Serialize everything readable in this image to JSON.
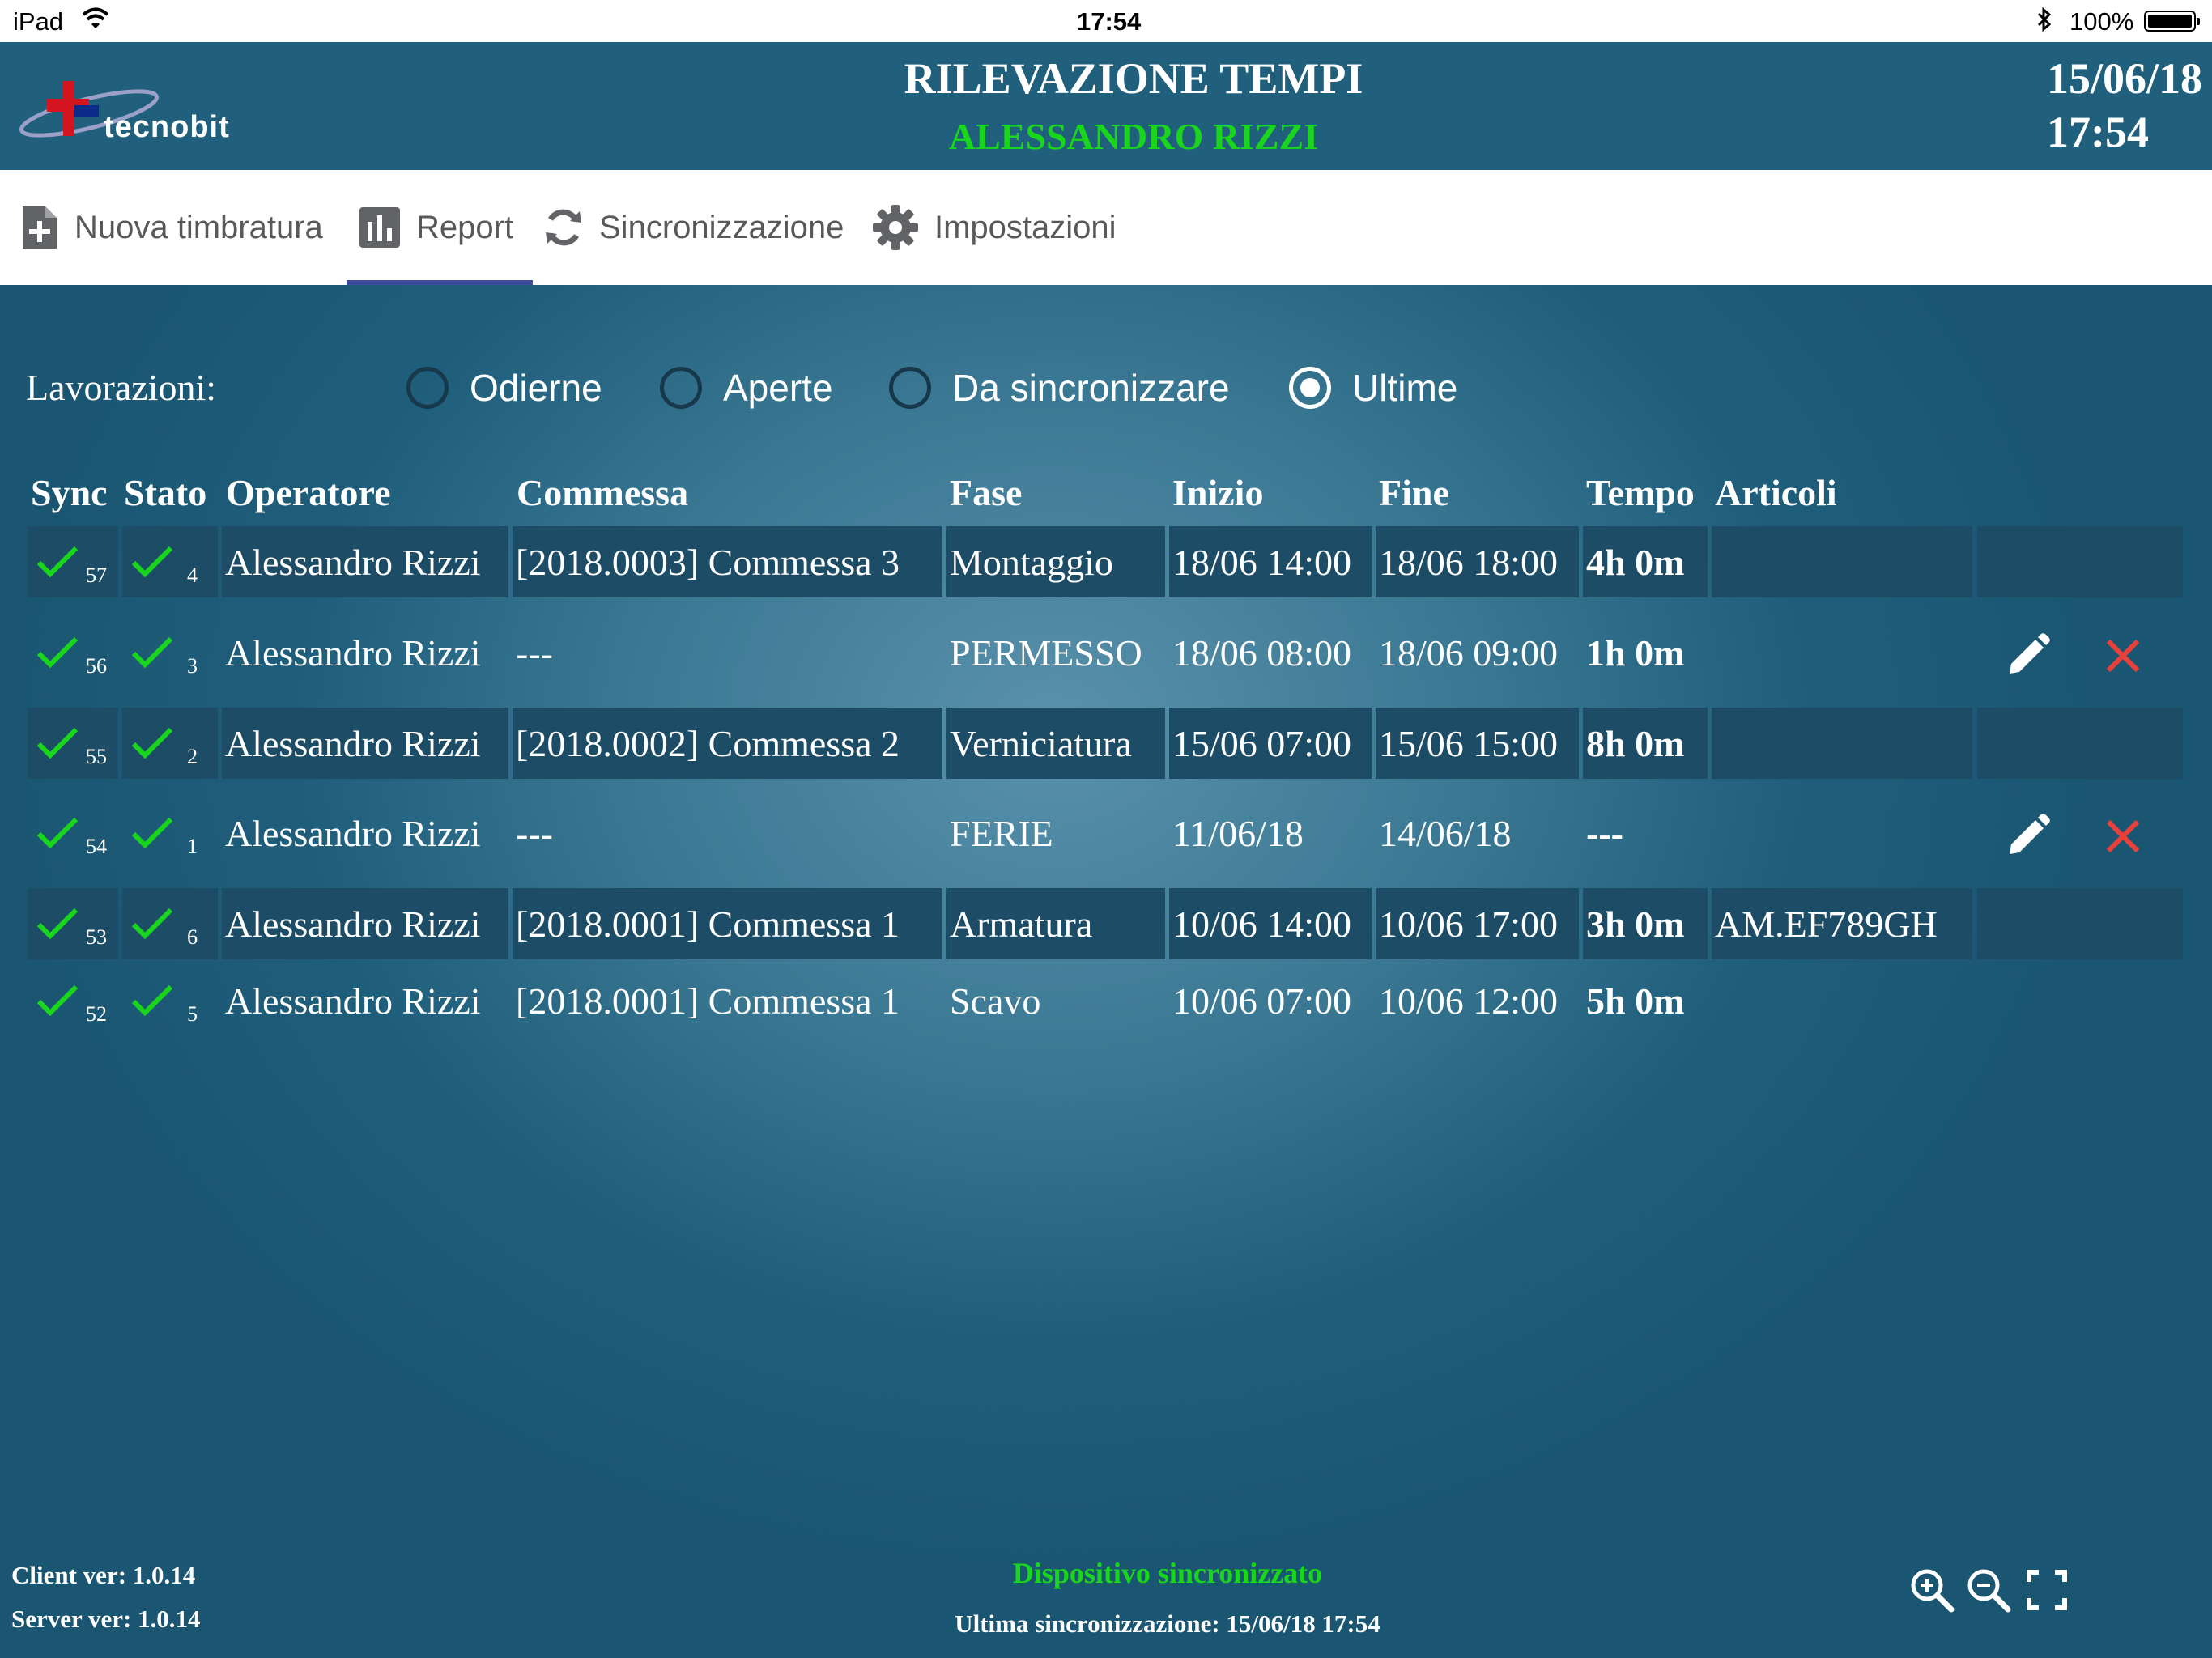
{
  "status_bar": {
    "device": "iPad",
    "time": "17:54",
    "battery_pct": "100%"
  },
  "header": {
    "logo_text": "tecnobit",
    "title": "RILEVAZIONE TEMPI",
    "user": "ALESSANDRO RIZZI",
    "date": "15/06/18",
    "time": "17:54"
  },
  "tabs": [
    {
      "label": "Nuova timbratura",
      "icon": "add-document-icon"
    },
    {
      "label": "Report",
      "icon": "bar-chart-icon",
      "active": true
    },
    {
      "label": "Sincronizzazione",
      "icon": "sync-icon"
    },
    {
      "label": "Impostazioni",
      "icon": "gear-icon"
    }
  ],
  "filter": {
    "label": "Lavorazioni:",
    "options": [
      {
        "label": "Odierne",
        "selected": false
      },
      {
        "label": "Aperte",
        "selected": false
      },
      {
        "label": "Da sincronizzare",
        "selected": false
      },
      {
        "label": "Ultime",
        "selected": true
      }
    ]
  },
  "table": {
    "columns": [
      "Sync",
      "Stato",
      "Operatore",
      "Commessa",
      "Fase",
      "Inizio",
      "Fine",
      "Tempo",
      "Articoli"
    ],
    "rows": [
      {
        "sync": "57",
        "stato": "4",
        "operatore": "Alessandro Rizzi",
        "commessa": "[2018.0003] Commessa 3",
        "fase": "Montaggio",
        "inizio": "18/06 14:00",
        "fine": "18/06 18:00",
        "tempo": "4h 0m",
        "articoli": "",
        "editable": false
      },
      {
        "sync": "56",
        "stato": "3",
        "operatore": "Alessandro Rizzi",
        "commessa": "---",
        "fase": "PERMESSO",
        "inizio": "18/06 08:00",
        "fine": "18/06 09:00",
        "tempo": "1h 0m",
        "articoli": "",
        "editable": true
      },
      {
        "sync": "55",
        "stato": "2",
        "operatore": "Alessandro Rizzi",
        "commessa": "[2018.0002] Commessa 2",
        "fase": "Verniciatura",
        "inizio": "15/06 07:00",
        "fine": "15/06 15:00",
        "tempo": "8h 0m",
        "articoli": "",
        "editable": false
      },
      {
        "sync": "54",
        "stato": "1",
        "operatore": "Alessandro Rizzi",
        "commessa": "---",
        "fase": "FERIE",
        "inizio": "11/06/18",
        "fine": "14/06/18",
        "tempo": "---",
        "articoli": "",
        "editable": true
      },
      {
        "sync": "53",
        "stato": "6",
        "operatore": "Alessandro Rizzi",
        "commessa": "[2018.0001] Commessa 1",
        "fase": "Armatura",
        "inizio": "10/06 14:00",
        "fine": "10/06 17:00",
        "tempo": "3h 0m",
        "articoli": "AM.EF789GH",
        "editable": false
      },
      {
        "sync": "52",
        "stato": "5",
        "operatore": "Alessandro Rizzi",
        "commessa": "[2018.0001] Commessa 1",
        "fase": "Scavo",
        "inizio": "10/06 07:00",
        "fine": "10/06 12:00",
        "tempo": "5h 0m",
        "articoli": "",
        "editable": false
      }
    ]
  },
  "footer": {
    "client_version": "Client ver: 1.0.14",
    "server_version": "Server ver: 1.0.14",
    "sync_status": "Dispositivo sincronizzato",
    "last_sync": "Ultima sincronizzazione: 15/06/18 17:54"
  },
  "colors": {
    "header_bg": "#21607c",
    "accent_green": "#19d61d",
    "delete_red": "#e8413b",
    "tab_underline": "#3d4d9c",
    "row_dark": "#1c4c66"
  }
}
